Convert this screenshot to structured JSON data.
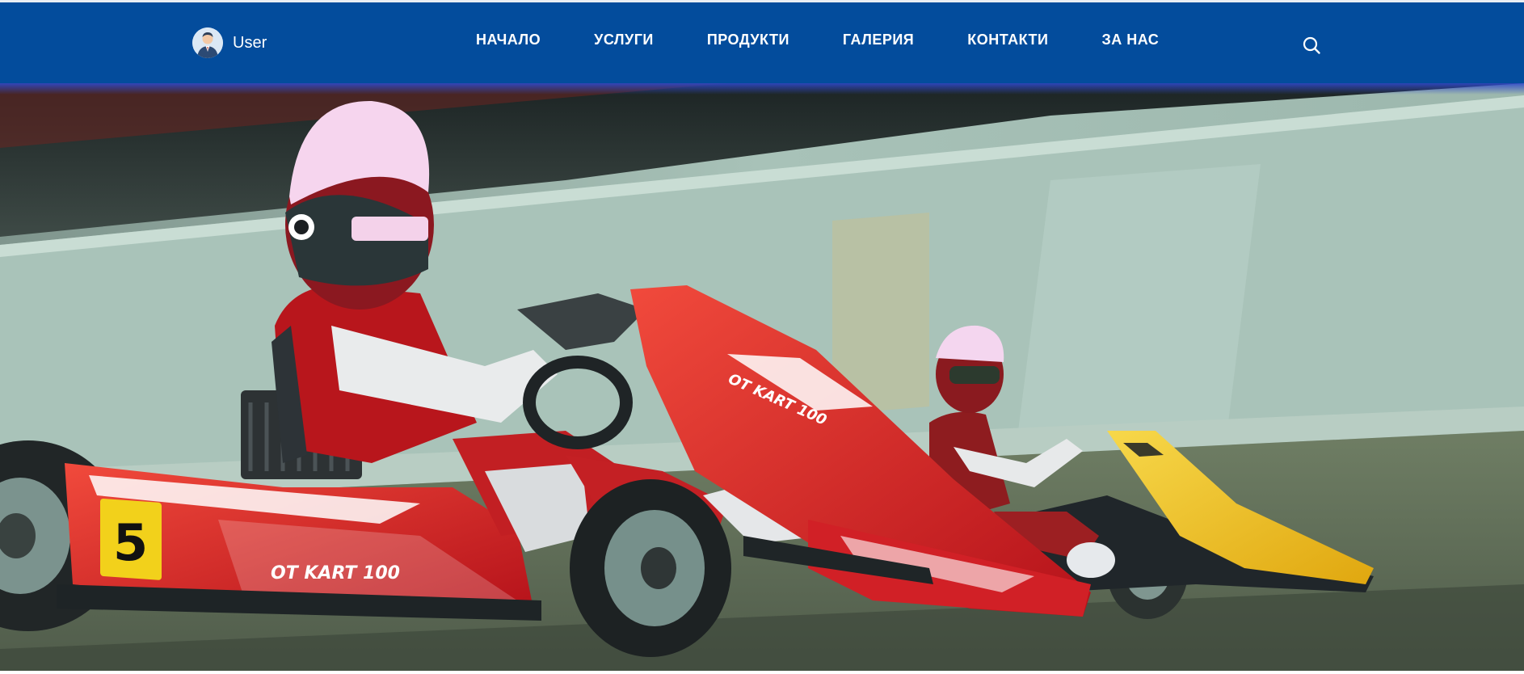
{
  "header": {
    "user_label": "User",
    "nav_items": [
      "НАЧАЛО",
      "УСЛУГИ",
      "ПРОДУКТИ",
      "ГАЛЕРИЯ",
      "КОНТАКТИ",
      "ЗА НАС"
    ],
    "brand_color": "#034c9c",
    "icons": {
      "avatar": "user-avatar-icon",
      "search": "search-icon"
    }
  },
  "hero": {
    "kart_number": "5",
    "kart_brand": "OT KART 100",
    "colors": {
      "kart_main": "#d8221f",
      "kart_second": "#f2c21b",
      "barrier": "#9fbab0",
      "track": "#5b6b55"
    }
  }
}
